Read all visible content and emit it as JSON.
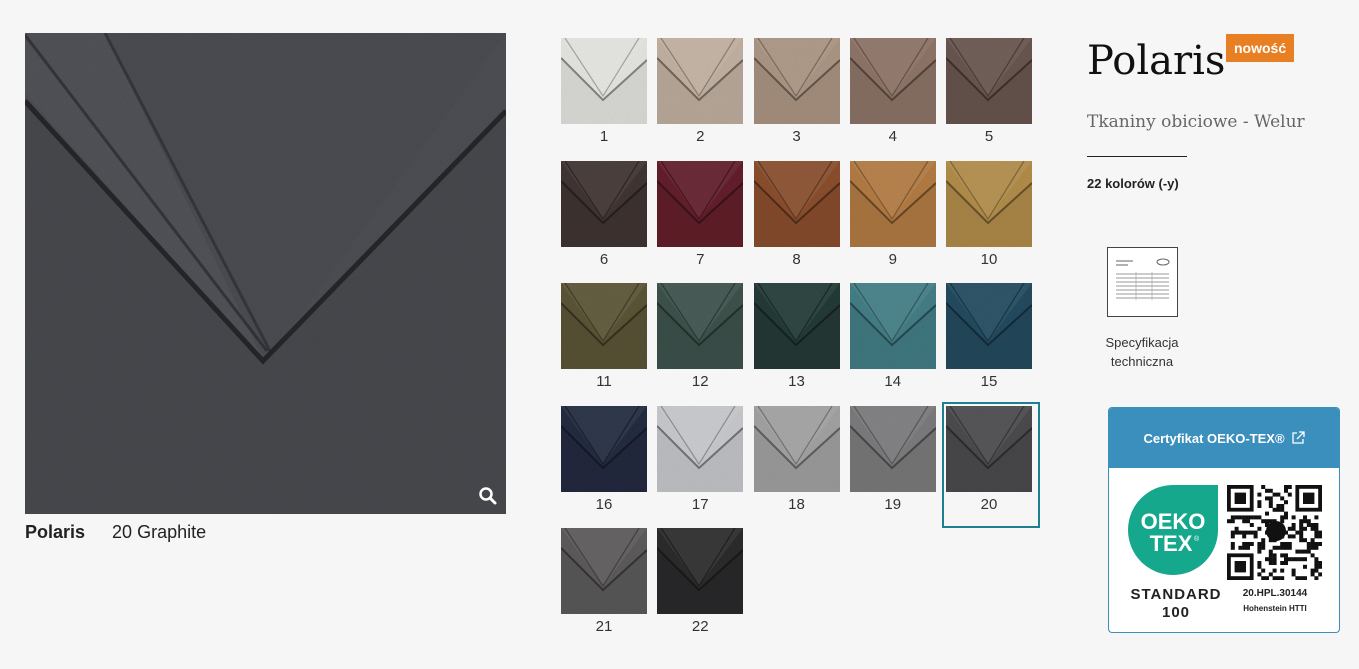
{
  "product": {
    "name": "Polaris",
    "selected_color_label": "20 Graphite",
    "badge": "nowość",
    "category": "Tkaniny obiciowe - Welur",
    "color_count": "22 kolorów (-y)"
  },
  "swatches": [
    {
      "number": "1",
      "color": "#e6e6e2"
    },
    {
      "number": "2",
      "color": "#c3b2a2"
    },
    {
      "number": "3",
      "color": "#ad9785"
    },
    {
      "number": "4",
      "color": "#8f7568"
    },
    {
      "number": "5",
      "color": "#6a5650"
    },
    {
      "number": "6",
      "color": "#413533"
    },
    {
      "number": "7",
      "color": "#64202c"
    },
    {
      "number": "8",
      "color": "#8b4f2e"
    },
    {
      "number": "9",
      "color": "#b47c44"
    },
    {
      "number": "10",
      "color": "#b38e4b"
    },
    {
      "number": "11",
      "color": "#5c5537"
    },
    {
      "number": "12",
      "color": "#3e534d"
    },
    {
      "number": "13",
      "color": "#243b38"
    },
    {
      "number": "14",
      "color": "#447f87"
    },
    {
      "number": "15",
      "color": "#234b60"
    },
    {
      "number": "16",
      "color": "#232c41"
    },
    {
      "number": "17",
      "color": "#c9cacd"
    },
    {
      "number": "18",
      "color": "#a4a3a4"
    },
    {
      "number": "19",
      "color": "#7c7c7e"
    },
    {
      "number": "20",
      "color": "#4c4c4f",
      "selected": true
    },
    {
      "number": "21",
      "color": "#5d5b5c"
    },
    {
      "number": "22",
      "color": "#2c2c2d"
    }
  ],
  "spec": {
    "line1": "Specyfikacja",
    "line2": "techniczna",
    "icon": "document-icon"
  },
  "certificate": {
    "header": "Certyfikat OEKO-TEX®",
    "logo_text_1": "OEKO",
    "logo_text_2": "TEX",
    "standard_line1": "STANDARD",
    "standard_line2": "100",
    "code": "20.HPL.30144",
    "lab": "Hohenstein HTTI",
    "external_icon": "external-link-icon"
  },
  "colors": {
    "badge": "#e87f22",
    "accent": "#3b8fbd",
    "selected_border": "#1d7f91",
    "oeko_green": "#15a88c"
  }
}
